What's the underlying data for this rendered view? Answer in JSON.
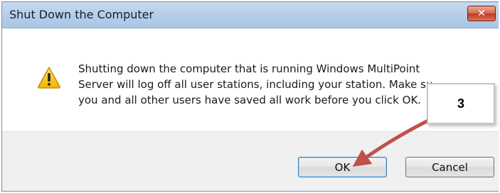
{
  "dialog": {
    "title": "Shut Down the Computer",
    "close_icon": "close-icon",
    "warning_icon": "warning-icon",
    "message_lines": [
      "Shutting down the computer that is running Windows MultiPoint",
      "Server will log off all user stations, including your station. Make su",
      "you and all other users have saved all work before you click OK."
    ],
    "buttons": {
      "ok": "OK",
      "cancel": "Cancel"
    }
  },
  "annotation": {
    "step": "3",
    "arrow_color": "#c0504d"
  }
}
